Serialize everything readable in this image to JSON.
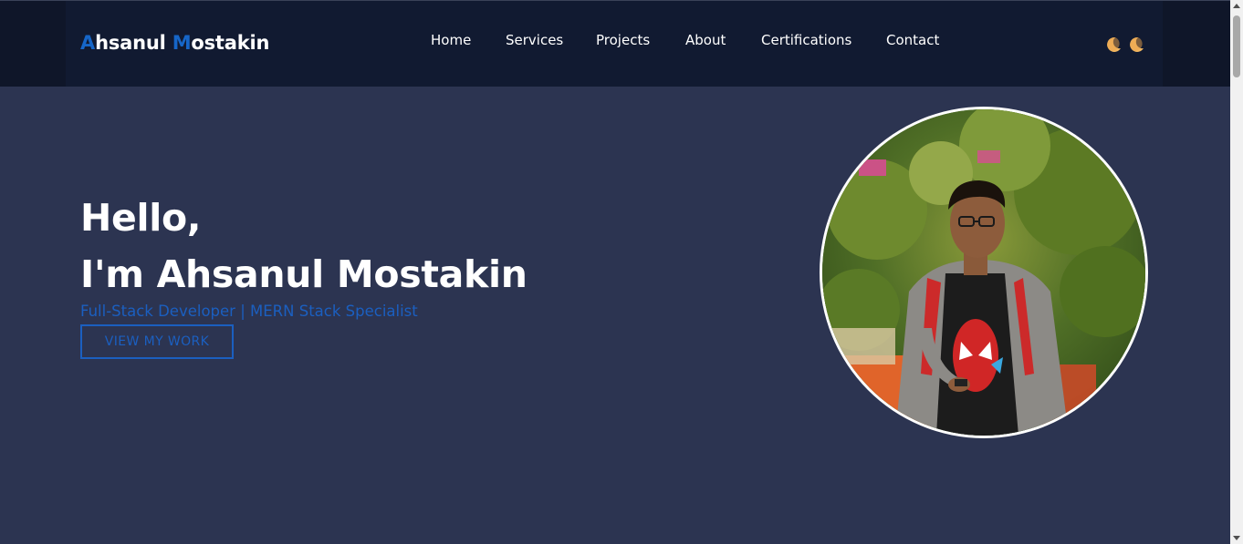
{
  "header": {
    "logo": {
      "first_initial": "A",
      "first_rest": "hsanul ",
      "second_initial": "M",
      "second_rest": "ostakin"
    },
    "nav": [
      {
        "label": "Home"
      },
      {
        "label": "Services"
      },
      {
        "label": "Projects"
      },
      {
        "label": "About"
      },
      {
        "label": "Certifications"
      },
      {
        "label": "Contact"
      }
    ],
    "theme_toggles": [
      {
        "icon": "moon-icon"
      },
      {
        "icon": "moon-icon"
      }
    ]
  },
  "hero": {
    "greeting": "Hello,",
    "intro": "I'm Ahsanul Mostakin",
    "subtitle": "Full-Stack Developer | MERN Stack Specialist",
    "cta_label": "VIEW MY WORK"
  },
  "colors": {
    "background": "#2c3451",
    "header_bg": "#111a31",
    "accent": "#1666c8",
    "moon": "#f2b760"
  }
}
